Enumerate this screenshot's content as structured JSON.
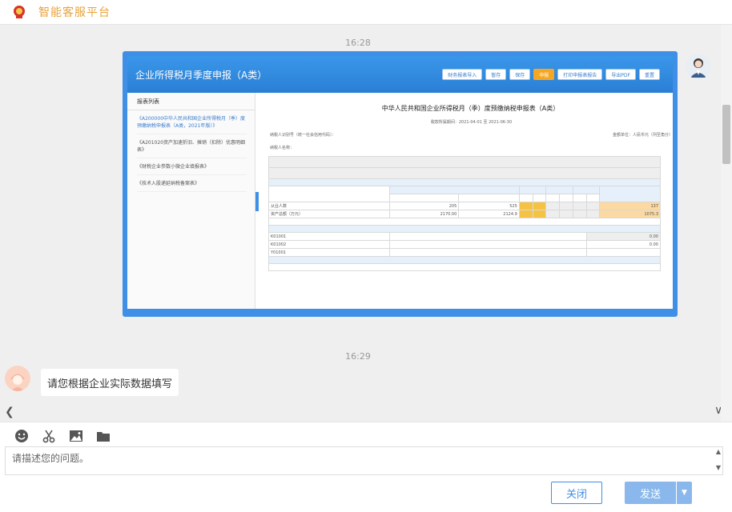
{
  "header": {
    "title": "智能客服平台",
    "logo": "tax-emblem-logo"
  },
  "chat": {
    "timestamps": [
      "16:28",
      "16:29"
    ],
    "screenshot_message": {
      "window_title": "企业所得税月季度申报（A类）",
      "toolbar_buttons": [
        "财务报表导入",
        "暂存",
        "保存",
        "申报",
        "打印申报表报告",
        "导出PDF",
        "重置"
      ],
      "highlighted_button_index": 3,
      "sidebar_title": "报表列表",
      "sidebar_items": [
        "《A200000中华人民共和国企业所得税月（季）度预缴纳税申报表（A类，2021年版）》",
        "《A201020资产加速折旧、摊销（扣除）优惠明细表》",
        "《财税企业参数小微企业填报表》",
        "《技术入股递延纳税备案表》"
      ],
      "form_title": "中华人民共和国企业所得税月（季）度预缴纳税申报表（A类）",
      "form_period": "税款所属期间：2021-04-01 至 2021-06-30",
      "form_taxpayer_label": "纳税人识别号（统一社会信用代码）：",
      "form_name_label": "纳税人名称：",
      "form_unit": "金额单位：人民币元（列至角分）",
      "rows": [
        {
          "label": "从业人数",
          "q1_start": "205",
          "q1_end": "525",
          "avg": "137"
        },
        {
          "label": "资产总额（万元）",
          "q1_start": "2170.00",
          "q1_end": "2124.9",
          "avg": "1075.3"
        }
      ],
      "row_codes": [
        "K01001",
        "K01002",
        "Y01001"
      ],
      "row_values": [
        "0.00",
        "0.00"
      ]
    },
    "user_message": "请您根据企业实际数据填写"
  },
  "input": {
    "placeholder": "请描述您的问题。",
    "close_label": "关闭",
    "send_label": "发送",
    "tools": [
      "emoji-icon",
      "scissors-icon",
      "image-icon",
      "folder-icon"
    ]
  },
  "colors": {
    "accent": "#3f8fe6",
    "brand": "#e8a33c"
  }
}
